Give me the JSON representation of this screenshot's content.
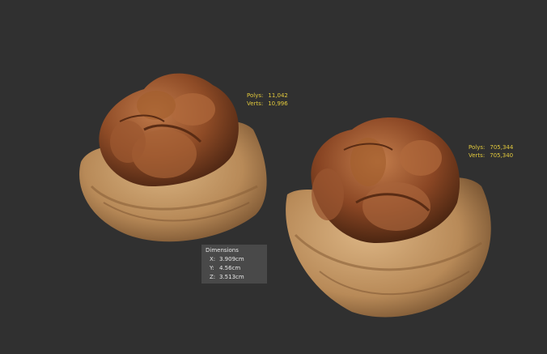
{
  "models": [
    {
      "stats": {
        "polys_label": "Polys:",
        "polys_value": "11,042",
        "verts_label": "Verts:",
        "verts_value": "10,996"
      }
    },
    {
      "stats": {
        "polys_label": "Polys:",
        "polys_value": "705,344",
        "verts_label": "Verts:",
        "verts_value": "705,340"
      }
    }
  ],
  "dimensions": {
    "title": "Dimensions",
    "x_label": "X:",
    "x_value": "3.909cm",
    "y_label": "Y:",
    "y_value": "4.56cm",
    "z_label": "Z:",
    "z_value": "3.513cm"
  },
  "colors": {
    "background": "#303030",
    "stats_text": "#e2c93c",
    "shell": "#c49a6a",
    "kernel": "#8a4a26"
  }
}
